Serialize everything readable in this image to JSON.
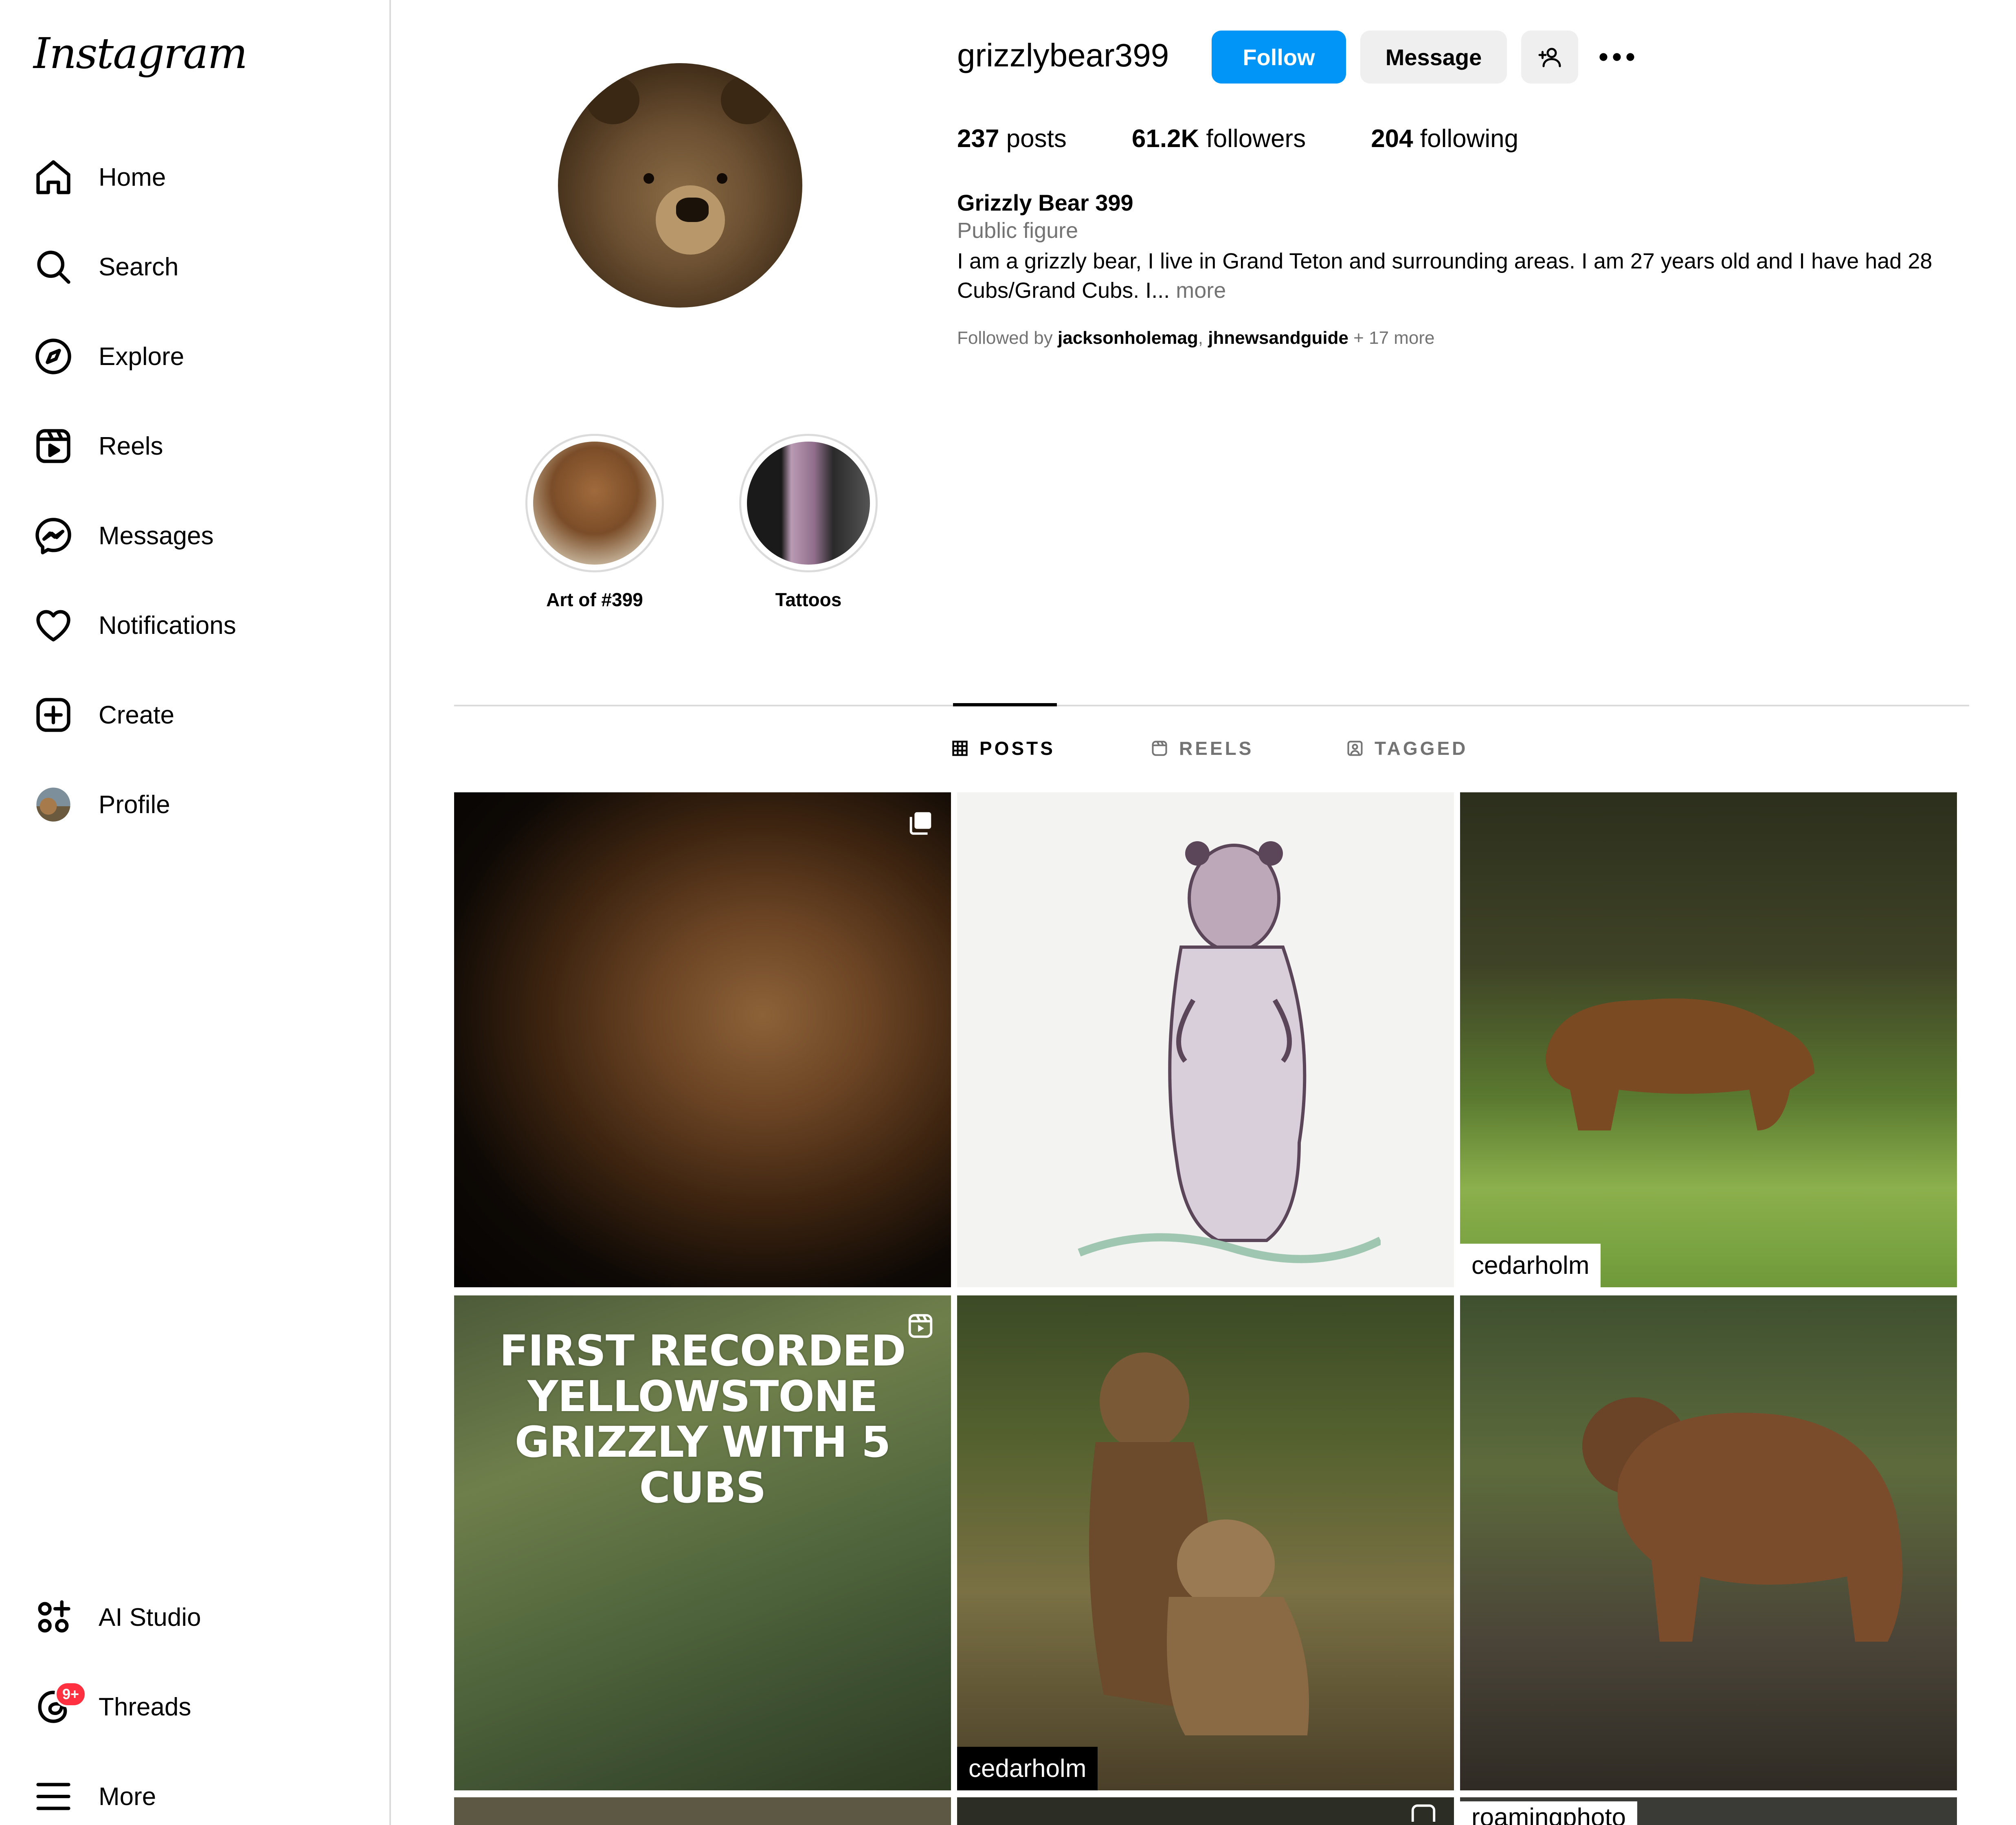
{
  "sidebar": {
    "logo": "Instagram",
    "items": [
      {
        "label": "Home",
        "icon": "home-icon"
      },
      {
        "label": "Search",
        "icon": "search-icon"
      },
      {
        "label": "Explore",
        "icon": "compass-icon"
      },
      {
        "label": "Reels",
        "icon": "reels-icon"
      },
      {
        "label": "Messages",
        "icon": "messenger-icon"
      },
      {
        "label": "Notifications",
        "icon": "heart-icon"
      },
      {
        "label": "Create",
        "icon": "plus-square-icon"
      },
      {
        "label": "Profile",
        "icon": "profile-avatar"
      }
    ],
    "bottom_items": [
      {
        "label": "AI Studio",
        "icon": "ai-studio-icon"
      },
      {
        "label": "Threads",
        "icon": "threads-icon",
        "badge": "9+"
      },
      {
        "label": "More",
        "icon": "hamburger-icon"
      }
    ]
  },
  "profile": {
    "username": "grizzlybear399",
    "follow_label": "Follow",
    "message_label": "Message",
    "add_user_icon": "add-user-icon",
    "more_icon": "more-horizontal-icon",
    "stats": {
      "posts_value": "237",
      "posts_label": " posts",
      "followers_value": "61.2K",
      "followers_label": " followers",
      "following_value": "204",
      "following_label": " following"
    },
    "full_name": "Grizzly Bear 399",
    "category": "Public figure",
    "bio": "I am a grizzly bear, I live in Grand Teton and surrounding areas. I am 27 years old and I have had 28 Cubs/Grand Cubs. I...",
    "bio_more": " more",
    "followed_by_prefix": "Followed by ",
    "followed_by_1": "jacksonholemag",
    "followed_by_sep": ", ",
    "followed_by_2": "jhnewsandguide",
    "followed_by_suffix": " + 17 more"
  },
  "highlights": [
    {
      "label": "Art of #399"
    },
    {
      "label": "Tattoos"
    }
  ],
  "tabs": [
    {
      "label": "POSTS",
      "icon": "grid-icon",
      "active": true
    },
    {
      "label": "REELS",
      "icon": "reels-icon",
      "active": false
    },
    {
      "label": "TAGGED",
      "icon": "tagged-icon",
      "active": false
    }
  ],
  "posts": [
    {
      "overlay_text": "",
      "watermark": "",
      "icon": "carousel-icon"
    },
    {
      "overlay_text": "",
      "watermark": "",
      "icon": ""
    },
    {
      "overlay_text": "",
      "watermark": "cedarholm",
      "icon": ""
    },
    {
      "overlay_text": "FIRST RECORDED YELLOWSTONE GRIZZLY WITH 5 CUBS",
      "watermark": "",
      "icon": "reel-icon"
    },
    {
      "overlay_text": "",
      "watermark": "cedarholm",
      "icon": ""
    },
    {
      "overlay_text": "",
      "watermark": "",
      "icon": ""
    },
    {
      "overlay_text": "",
      "watermark": "",
      "icon": ""
    },
    {
      "overlay_text": "",
      "watermark": "",
      "icon": "reel-icon"
    },
    {
      "overlay_text": "",
      "watermark": "roamingphoto",
      "icon": ""
    }
  ],
  "colors": {
    "follow_button": "#0095f6",
    "secondary_button": "#efefef",
    "badge": "#ff3040",
    "muted_text": "#737373",
    "divider": "#dbdbdb"
  }
}
